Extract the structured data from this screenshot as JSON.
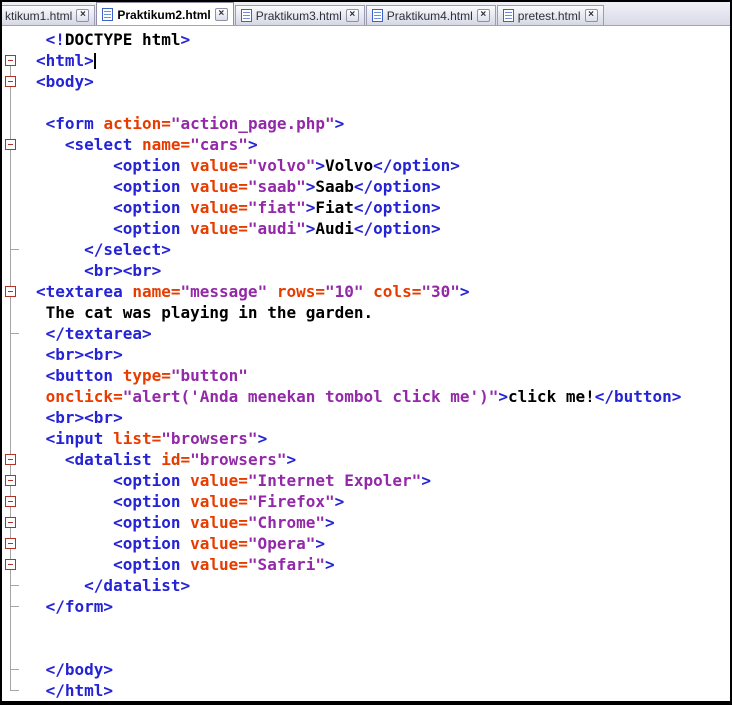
{
  "tab_bar": {
    "close_glyph": "×",
    "tabs": [
      {
        "label": "ktikum1.html",
        "active": false,
        "icon": false
      },
      {
        "label": "Praktikum2.html",
        "active": true,
        "icon": true
      },
      {
        "label": "Praktikum3.html",
        "active": false,
        "icon": true
      },
      {
        "label": "Praktikum4.html",
        "active": false,
        "icon": true
      },
      {
        "label": "pretest.html",
        "active": false,
        "icon": true
      }
    ]
  },
  "colors": {
    "tag": "#2424d6",
    "attribute": "#e73c00",
    "value": "#9329a8",
    "text": "#000000",
    "fold_box": "#b03228",
    "fold_line": "#a6a6a6",
    "tab_bar_bg": "#d9dae6",
    "active_tab_bg": "#ffffff"
  },
  "editor": {
    "lines": [
      {
        "m": "",
        "seg": [
          [
            "tg",
            " <!"
          ],
          [
            "tx",
            "DOCTYPE html"
          ],
          [
            "tg",
            ">"
          ]
        ]
      },
      {
        "m": "bstart",
        "cursor": true,
        "seg": [
          [
            "tg",
            "<html>"
          ]
        ]
      },
      {
        "m": "b",
        "seg": [
          [
            "tg",
            "<body>"
          ]
        ]
      },
      {
        "m": "v",
        "seg": []
      },
      {
        "m": "v",
        "seg": [
          [
            "tg",
            " <form "
          ],
          [
            "at",
            "action="
          ],
          [
            "vl",
            "\"action_page.php\""
          ],
          [
            "tg",
            ">"
          ]
        ]
      },
      {
        "m": "b",
        "seg": [
          [
            "tg",
            "   <select "
          ],
          [
            "at",
            "name="
          ],
          [
            "vl",
            "\"cars\""
          ],
          [
            "tg",
            ">"
          ]
        ]
      },
      {
        "m": "v",
        "seg": [
          [
            "tg",
            "        <option "
          ],
          [
            "at",
            "value="
          ],
          [
            "vl",
            "\"volvo\""
          ],
          [
            "tg",
            ">"
          ],
          [
            "tx",
            "Volvo"
          ],
          [
            "tg",
            "</option>"
          ]
        ]
      },
      {
        "m": "v",
        "seg": [
          [
            "tg",
            "        <option "
          ],
          [
            "at",
            "value="
          ],
          [
            "vl",
            "\"saab\""
          ],
          [
            "tg",
            ">"
          ],
          [
            "tx",
            "Saab"
          ],
          [
            "tg",
            "</option>"
          ]
        ]
      },
      {
        "m": "v",
        "seg": [
          [
            "tg",
            "        <option "
          ],
          [
            "at",
            "value="
          ],
          [
            "vl",
            "\"fiat\""
          ],
          [
            "tg",
            ">"
          ],
          [
            "tx",
            "Fiat"
          ],
          [
            "tg",
            "</option>"
          ]
        ]
      },
      {
        "m": "v",
        "seg": [
          [
            "tg",
            "        <option "
          ],
          [
            "at",
            "value="
          ],
          [
            "vl",
            "\"audi\""
          ],
          [
            "tg",
            ">"
          ],
          [
            "tx",
            "Audi"
          ],
          [
            "tg",
            "</option>"
          ]
        ]
      },
      {
        "m": "t",
        "seg": [
          [
            "tg",
            "     </select>"
          ]
        ]
      },
      {
        "m": "v",
        "seg": [
          [
            "tg",
            "     <br><br>"
          ]
        ]
      },
      {
        "m": "b",
        "seg": [
          [
            "tg",
            "<textarea "
          ],
          [
            "at",
            "name="
          ],
          [
            "vl",
            "\"message\""
          ],
          [
            "at",
            " rows="
          ],
          [
            "vl",
            "\"10\""
          ],
          [
            "at",
            " cols="
          ],
          [
            "vl",
            "\"30\""
          ],
          [
            "tg",
            ">"
          ]
        ]
      },
      {
        "m": "v",
        "seg": [
          [
            "tx",
            " The cat was playing in the garden."
          ]
        ]
      },
      {
        "m": "t",
        "seg": [
          [
            "tg",
            " </textarea>"
          ]
        ]
      },
      {
        "m": "v",
        "seg": [
          [
            "tg",
            " <br><br>"
          ]
        ]
      },
      {
        "m": "v",
        "seg": [
          [
            "tg",
            " <button "
          ],
          [
            "at",
            "type="
          ],
          [
            "vl",
            "\"button\""
          ]
        ]
      },
      {
        "m": "v",
        "seg": [
          [
            "at",
            " onclick="
          ],
          [
            "vl",
            "\"alert('Anda menekan tombol click me')\""
          ],
          [
            "tg",
            ">"
          ],
          [
            "tx",
            "click me!"
          ],
          [
            "tg",
            "</button>"
          ]
        ]
      },
      {
        "m": "v",
        "seg": [
          [
            "tg",
            " <br><br>"
          ]
        ]
      },
      {
        "m": "v",
        "seg": [
          [
            "tg",
            " <input "
          ],
          [
            "at",
            "list="
          ],
          [
            "vl",
            "\"browsers\""
          ],
          [
            "tg",
            ">"
          ]
        ]
      },
      {
        "m": "b",
        "seg": [
          [
            "tg",
            "   <datalist "
          ],
          [
            "at",
            "id="
          ],
          [
            "vl",
            "\"browsers\""
          ],
          [
            "tg",
            ">"
          ]
        ]
      },
      {
        "m": "b",
        "seg": [
          [
            "tg",
            "        <option "
          ],
          [
            "at",
            "value="
          ],
          [
            "vl",
            "\"Internet Expoler\""
          ],
          [
            "tg",
            ">"
          ]
        ]
      },
      {
        "m": "b",
        "seg": [
          [
            "tg",
            "        <option "
          ],
          [
            "at",
            "value="
          ],
          [
            "vl",
            "\"Firefox\""
          ],
          [
            "tg",
            ">"
          ]
        ]
      },
      {
        "m": "b",
        "seg": [
          [
            "tg",
            "        <option "
          ],
          [
            "at",
            "value="
          ],
          [
            "vl",
            "\"Chrome\""
          ],
          [
            "tg",
            ">"
          ]
        ]
      },
      {
        "m": "b",
        "seg": [
          [
            "tg",
            "        <option "
          ],
          [
            "at",
            "value="
          ],
          [
            "vl",
            "\"Opera\""
          ],
          [
            "tg",
            ">"
          ]
        ]
      },
      {
        "m": "b",
        "seg": [
          [
            "tg",
            "        <option "
          ],
          [
            "at",
            "value="
          ],
          [
            "vl",
            "\"Safari\""
          ],
          [
            "tg",
            ">"
          ]
        ]
      },
      {
        "m": "t",
        "seg": [
          [
            "tg",
            "     </datalist>"
          ]
        ]
      },
      {
        "m": "t",
        "seg": [
          [
            "tg",
            " </form>"
          ]
        ]
      },
      {
        "m": "v",
        "seg": []
      },
      {
        "m": "v",
        "seg": []
      },
      {
        "m": "t",
        "seg": [
          [
            "tg",
            " </body>"
          ]
        ]
      },
      {
        "m": "tend",
        "seg": [
          [
            "tg",
            " </html>"
          ]
        ]
      }
    ]
  }
}
